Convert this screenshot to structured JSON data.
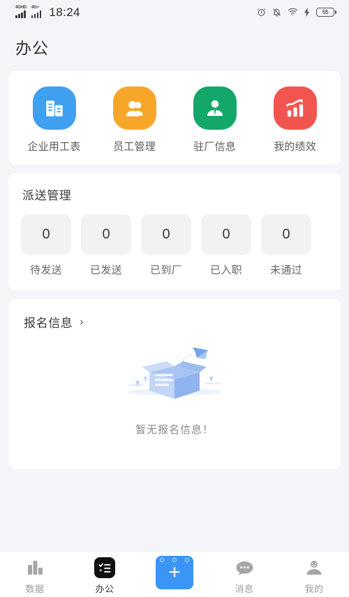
{
  "status_bar": {
    "signal_1_label": "4GHD",
    "signal_2_label": "4G+",
    "time": "18:24",
    "battery_level": "55",
    "icons": [
      "alarm-icon",
      "bell-muted-icon",
      "wifi-icon",
      "charging-bolt-icon",
      "battery-icon"
    ]
  },
  "header": {
    "title": "办公"
  },
  "quick_actions": {
    "items": [
      {
        "label": "企业用工表",
        "icon": "building-icon",
        "color": "#3fa0ef"
      },
      {
        "label": "员工管理",
        "icon": "users-icon",
        "color": "#f6a72a"
      },
      {
        "label": "驻厂信息",
        "icon": "manager-icon",
        "color": "#13a86a"
      },
      {
        "label": "我的绩效",
        "icon": "bar-chart-up-icon",
        "color": "#f2554f"
      }
    ]
  },
  "dispatch": {
    "title": "派送管理",
    "stats": [
      {
        "value": "0",
        "label": "待发送"
      },
      {
        "value": "0",
        "label": "已发送"
      },
      {
        "value": "0",
        "label": "已到厂"
      },
      {
        "value": "0",
        "label": "已入职"
      },
      {
        "value": "0",
        "label": "未通过"
      }
    ]
  },
  "signup": {
    "title": "报名信息",
    "chevron": "›",
    "empty_text": "暂无报名信息！",
    "empty_illustration": "empty-box-icon"
  },
  "tab_bar": {
    "tabs": [
      {
        "label": "数据",
        "icon": "bar-chart-icon",
        "active": false
      },
      {
        "label": "办公",
        "icon": "checklist-icon",
        "active": true
      },
      {
        "label": "消息",
        "icon": "chat-bubble-icon",
        "active": false
      },
      {
        "label": "我的",
        "icon": "person-icon",
        "active": false
      }
    ],
    "center_button": {
      "icon": "plus-icon",
      "color": "#3b95f5"
    }
  }
}
